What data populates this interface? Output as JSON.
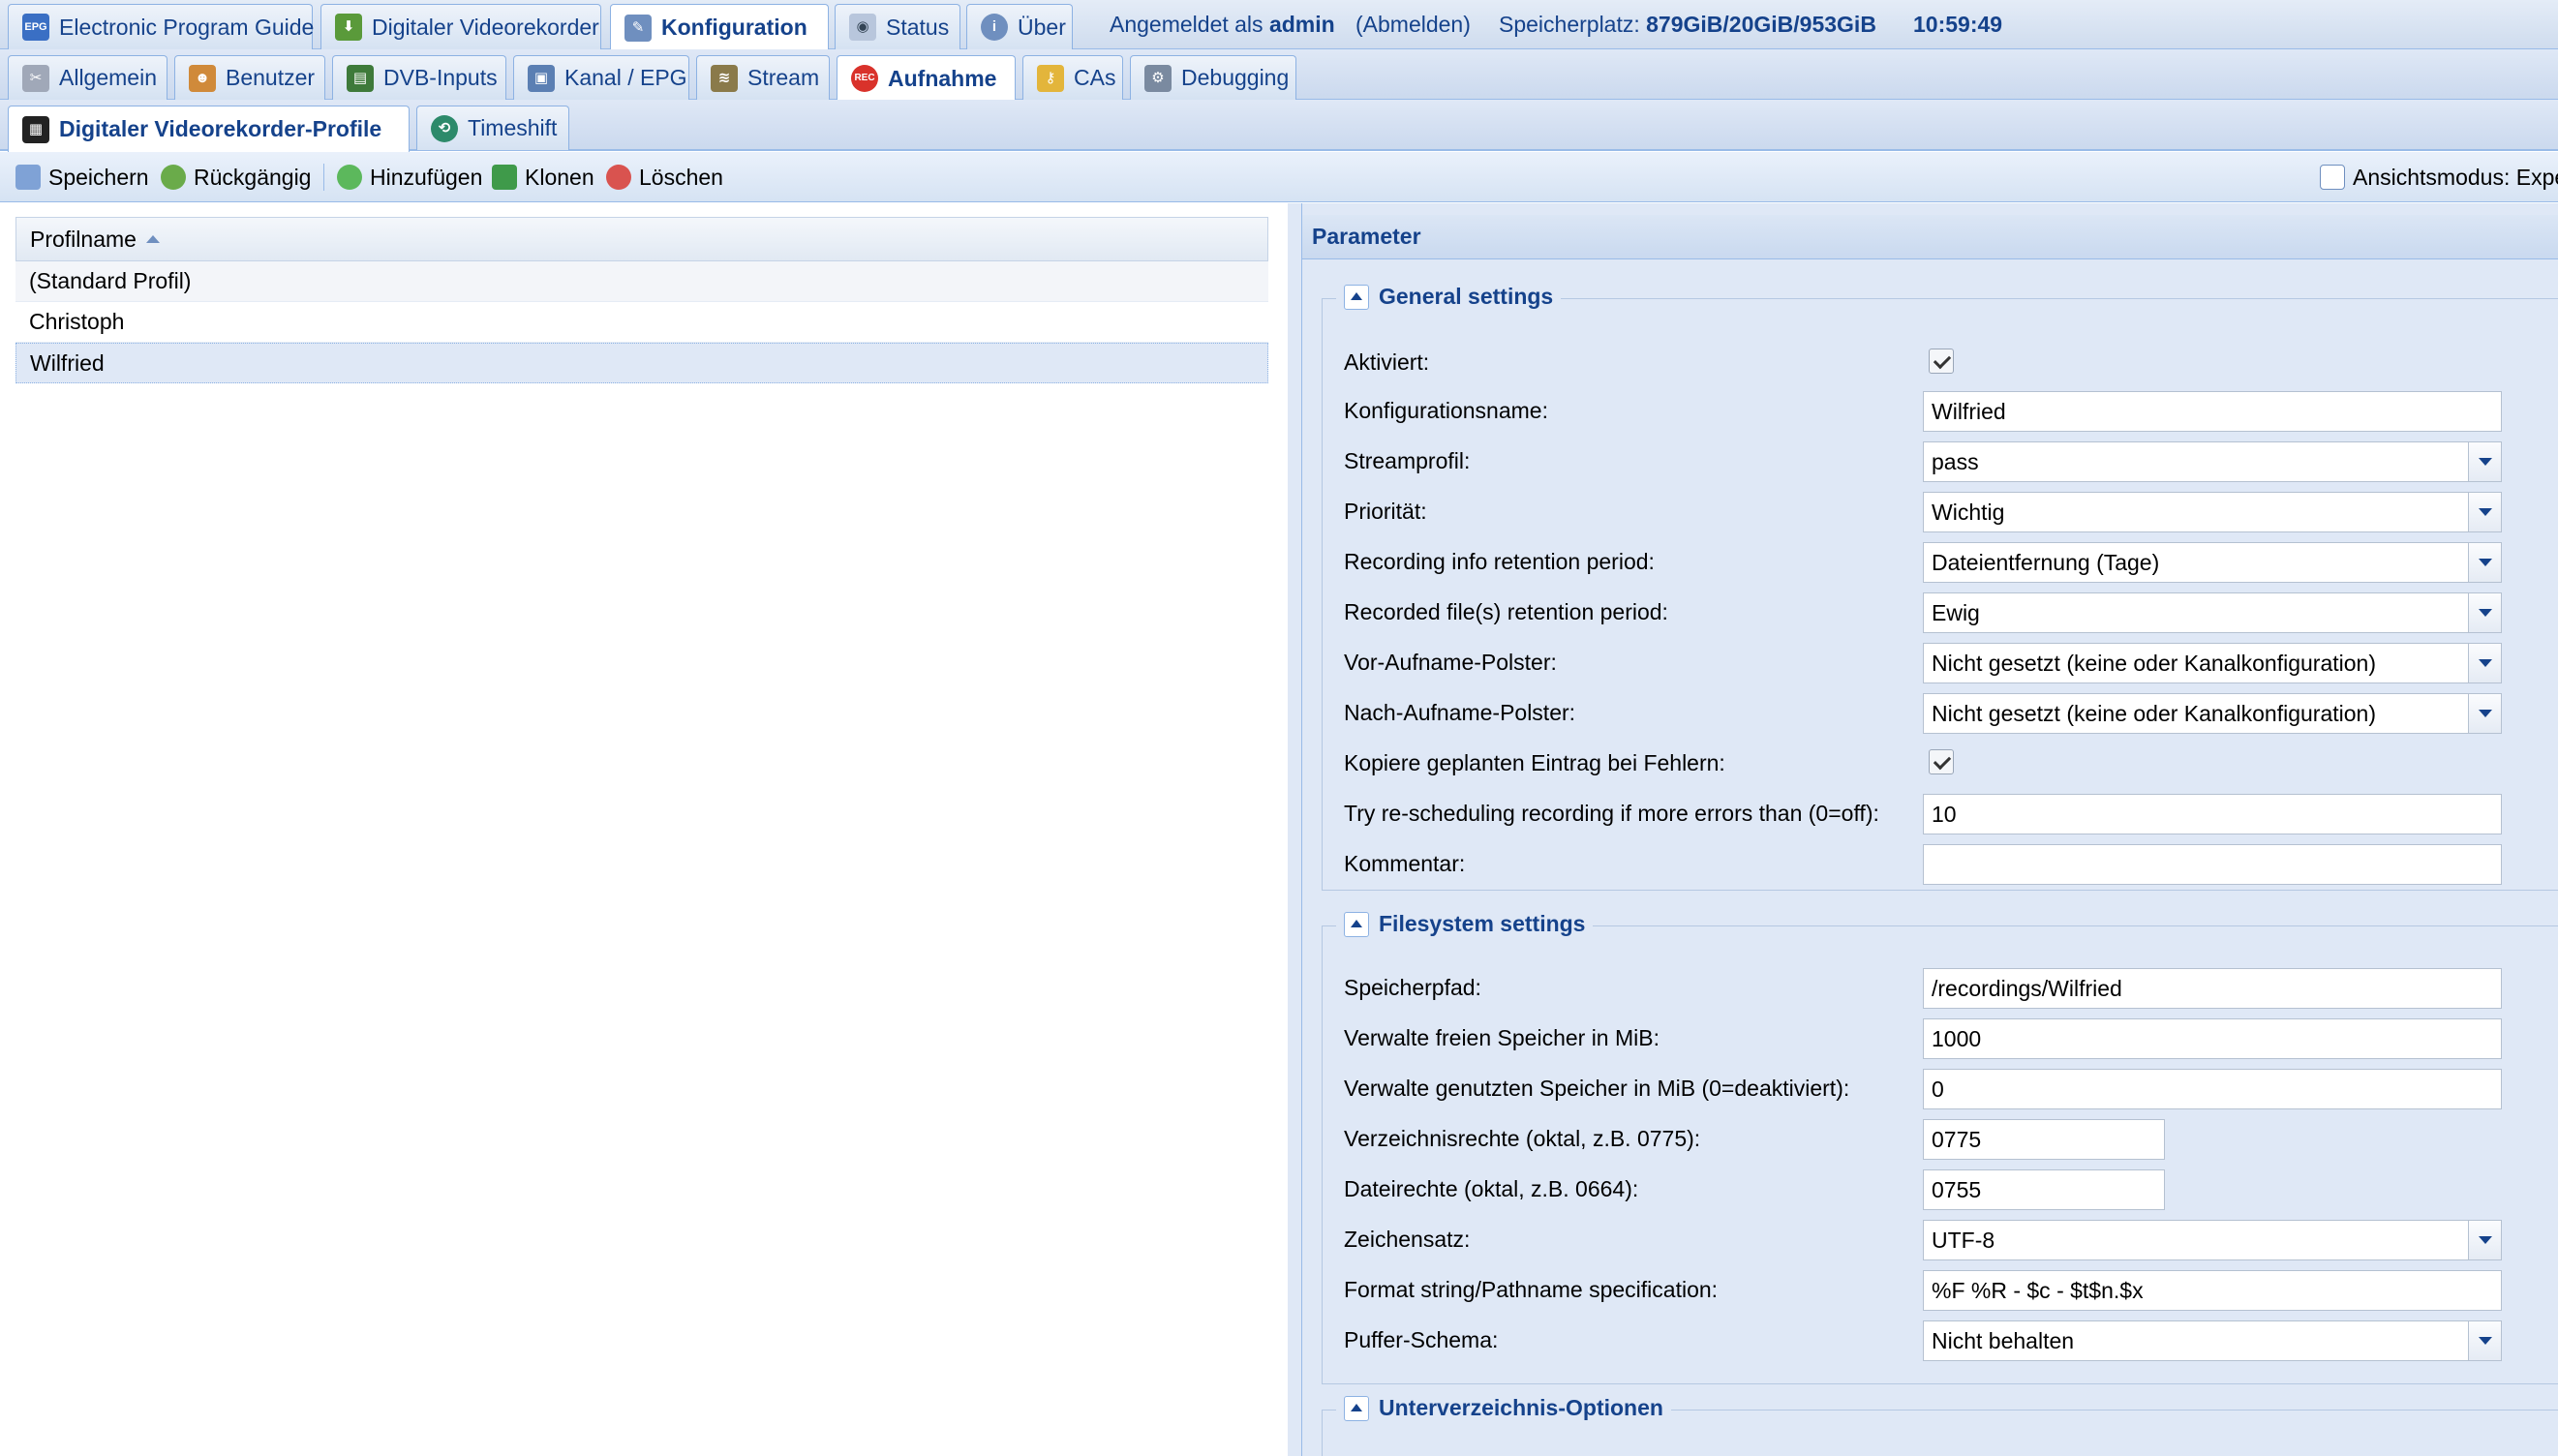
{
  "top_tabs": [
    {
      "label": "Electronic Program Guide",
      "icon": "epg-icon"
    },
    {
      "label": "Digitaler Videorekorder",
      "icon": "download-icon"
    },
    {
      "label": "Konfiguration",
      "icon": "wrench-icon"
    },
    {
      "label": "Status",
      "icon": "eye-icon"
    },
    {
      "label": "Über",
      "icon": "info-icon"
    }
  ],
  "status_bar": {
    "logged_in_prefix": "Angemeldet als",
    "user": "admin",
    "logout": "(Abmelden)",
    "storage_prefix": "Speicherplatz:",
    "storage_value": "879GiB/20GiB/953GiB",
    "clock": "10:59:49"
  },
  "config_tabs": [
    {
      "label": "Allgemein",
      "icon": "tools-icon"
    },
    {
      "label": "Benutzer",
      "icon": "users-icon"
    },
    {
      "label": "DVB-Inputs",
      "icon": "card-icon"
    },
    {
      "label": "Kanal / EPG",
      "icon": "tv-icon"
    },
    {
      "label": "Stream",
      "icon": "stream-icon"
    },
    {
      "label": "Aufnahme",
      "icon": "record-icon"
    },
    {
      "label": "CAs",
      "icon": "key-icon"
    },
    {
      "label": "Debugging",
      "icon": "bug-icon"
    }
  ],
  "sub_tabs": [
    {
      "label": "Digitaler Videorekorder-Profile",
      "icon": "dvr-profile-icon"
    },
    {
      "label": "Timeshift",
      "icon": "timeshift-icon"
    }
  ],
  "toolbar": {
    "save": "Speichern",
    "undo": "Rückgängig",
    "add": "Hinzufügen",
    "clone": "Klonen",
    "delete": "Löschen",
    "view_mode": "Ansichtsmodus: Expe"
  },
  "profile_grid": {
    "header": "Profilname",
    "rows": [
      "(Standard Profil)",
      "Christoph",
      "Wilfried"
    ],
    "selected_index": 2
  },
  "params": {
    "title": "Parameter",
    "general": {
      "legend": "General settings",
      "fields": [
        {
          "label": "Aktiviert:",
          "type": "checkbox",
          "checked": true
        },
        {
          "label": "Konfigurationsname:",
          "type": "text",
          "value": "Wilfried"
        },
        {
          "label": "Streamprofil:",
          "type": "select",
          "value": "pass"
        },
        {
          "label": "Priorität:",
          "type": "select",
          "value": "Wichtig"
        },
        {
          "label": "Recording info retention period:",
          "type": "select",
          "value": "Dateientfernung (Tage)"
        },
        {
          "label": "Recorded file(s) retention period:",
          "type": "select",
          "value": "Ewig"
        },
        {
          "label": "Vor-Aufname-Polster:",
          "type": "select",
          "value": "Nicht gesetzt (keine oder Kanalkonfiguration)"
        },
        {
          "label": "Nach-Aufname-Polster:",
          "type": "select",
          "value": "Nicht gesetzt (keine oder Kanalkonfiguration)"
        },
        {
          "label": "Kopiere geplanten Eintrag bei Fehlern:",
          "type": "checkbox",
          "checked": true
        },
        {
          "label": "Try re-scheduling recording if more errors than (0=off):",
          "type": "text",
          "value": "10"
        },
        {
          "label": "Kommentar:",
          "type": "text",
          "value": ""
        }
      ]
    },
    "filesystem": {
      "legend": "Filesystem settings",
      "fields": [
        {
          "label": "Speicherpfad:",
          "type": "text",
          "value": "/recordings/Wilfried"
        },
        {
          "label": "Verwalte freien Speicher in MiB:",
          "type": "text",
          "value": "1000"
        },
        {
          "label": "Verwalte genutzten Speicher in MiB (0=deaktiviert):",
          "type": "text",
          "value": "0"
        },
        {
          "label": "Verzeichnisrechte (oktal, z.B. 0775):",
          "type": "short",
          "value": "0775"
        },
        {
          "label": "Dateirechte (oktal, z.B. 0664):",
          "type": "short",
          "value": "0755"
        },
        {
          "label": "Zeichensatz:",
          "type": "select",
          "value": "UTF-8"
        },
        {
          "label": "Format string/Pathname specification:",
          "type": "text",
          "value": "%F %R - $c - $t$n.$x"
        },
        {
          "label": "Puffer-Schema:",
          "type": "select",
          "value": "Nicht behalten"
        }
      ]
    },
    "subdir": {
      "legend": "Unterverzeichnis-Optionen"
    }
  }
}
